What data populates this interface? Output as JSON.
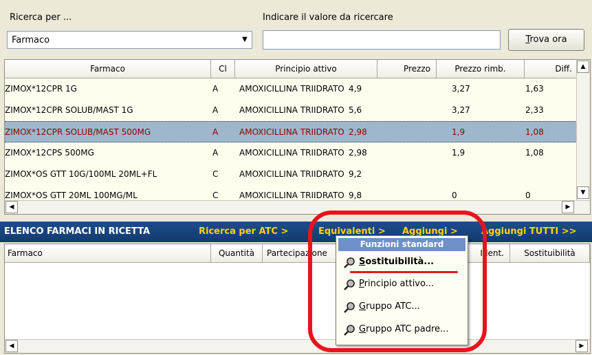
{
  "search": {
    "label_by": "Ricerca per ...",
    "by_value": "Farmaco",
    "label_value": "Indicare il valore da ricercare",
    "value": "",
    "find_prefix": "T",
    "find_rest": "rova ora"
  },
  "results": {
    "columns": [
      "Farmaco",
      "Cl",
      "Principio attivo",
      "Prezzo",
      "Prezzo rimb.",
      "Diff."
    ],
    "rows": [
      {
        "farmaco": "ZIMOX*12CPR 1G",
        "cl": "A",
        "principio": "AMOXICILLINA TRIIDRATO",
        "prezzo": "4,9",
        "rimb": "3,27",
        "diff": "1,63"
      },
      {
        "farmaco": "ZIMOX*12CPR SOLUB/MAST 1G",
        "cl": "A",
        "principio": "AMOXICILLINA TRIIDRATO",
        "prezzo": "5,6",
        "rimb": "3,27",
        "diff": "2,33"
      },
      {
        "farmaco": "ZIMOX*12CPR SOLUB/MAST 500MG",
        "cl": "A",
        "principio": "AMOXICILLINA TRIIDRATO",
        "prezzo": "2,98",
        "rimb": "1,9",
        "diff": "1,08",
        "selected": true
      },
      {
        "farmaco": "ZIMOX*12CPS 500MG",
        "cl": "A",
        "principio": "AMOXICILLINA TRIIDRATO",
        "prezzo": "2,98",
        "rimb": "1,9",
        "diff": "1,08"
      },
      {
        "farmaco": "ZIMOX*OS GTT 10G/100ML 20ML+FL",
        "cl": "C",
        "principio": "AMOXICILLINA TRIIDRATO",
        "prezzo": "9,2",
        "rimb": "",
        "diff": ""
      },
      {
        "farmaco": "ZIMOX*OS GTT 20ML 100MG/ML",
        "cl": "C",
        "principio": "AMOXICILLINA TRIIDRATO",
        "prezzo": "9,8",
        "rimb": "0",
        "diff": "0"
      }
    ]
  },
  "recipe_bar": {
    "title": "ELENCO FARMACI IN RICETTA",
    "atc": "Ricerca per ATC >",
    "equivalenti": "Equivalenti >",
    "aggiungi": "Aggiungi >",
    "aggiungi_tutti": "Aggiungi TUTTI >>"
  },
  "recipe": {
    "columns": [
      "Farmaco",
      "Quantità",
      "Partecipazione",
      "Ident.",
      "Sostituibilità"
    ]
  },
  "menu": {
    "header": "Funzioni standard",
    "items": [
      {
        "first": "S",
        "rest": "ostituibilità..."
      },
      {
        "first": "P",
        "rest": "rincipio attivo..."
      },
      {
        "first": "G",
        "rest": "ruppo ATC..."
      },
      {
        "first": "G",
        "rest": "ruppo ATC padre..."
      }
    ]
  },
  "colors": {
    "annotation": "#e8141c",
    "selection": "#9fb7cc",
    "bar": "#1e4d8c",
    "link": "#ffd700"
  },
  "icons": {
    "dropdown": "chevron-down-icon",
    "menu_item": "magnifier-icon"
  }
}
